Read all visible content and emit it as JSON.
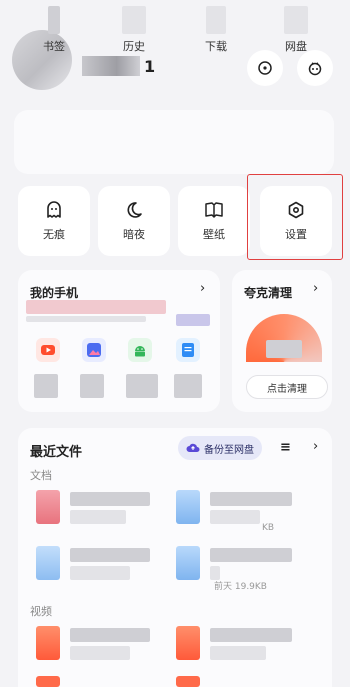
{
  "header": {
    "username_suffix": "1",
    "icons": [
      "scan-icon",
      "assistant-icon"
    ]
  },
  "shortcuts": [
    {
      "label": "书签"
    },
    {
      "label": "历史"
    },
    {
      "label": "下载"
    },
    {
      "label": "网盘"
    }
  ],
  "tools": [
    {
      "label": "无痕",
      "icon": "ghost-icon"
    },
    {
      "label": "暗夜",
      "icon": "moon-icon"
    },
    {
      "label": "壁纸",
      "icon": "book-icon"
    },
    {
      "label": "设置",
      "icon": "settings-icon"
    }
  ],
  "phone_card": {
    "title": "我的手机",
    "chevron": "›"
  },
  "clean_card": {
    "title": "夸克清理",
    "chevron": "›",
    "button": "点击清理"
  },
  "files_card": {
    "title": "最近文件",
    "backup_button": "备份至网盘",
    "sort_icon": "≡",
    "chevron": "›",
    "documents_label": "文档",
    "videos_label": "视频",
    "doc_meta_1": "KB",
    "doc_meta_2": "前天 19.9KB"
  },
  "colors": {
    "selection_border": "#e04040",
    "accent_blue": "#3a5bd9",
    "orange": "#ff6a3d"
  }
}
